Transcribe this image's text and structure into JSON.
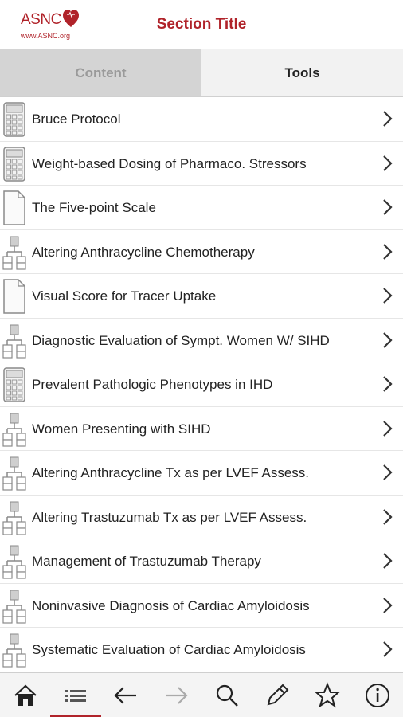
{
  "header": {
    "logo_text": "ASNC",
    "logo_url": "www.ASNC.org",
    "title": "Section Title"
  },
  "tabs": [
    {
      "label": "Content",
      "active": false
    },
    {
      "label": "Tools",
      "active": true
    }
  ],
  "list": {
    "items": [
      {
        "label": "Bruce Protocol",
        "icon": "calculator-icon"
      },
      {
        "label": "Weight-based Dosing of Pharmaco. Stressors",
        "icon": "calculator-icon"
      },
      {
        "label": "The Five-point Scale",
        "icon": "document-icon"
      },
      {
        "label": "Altering Anthracycline Chemotherapy",
        "icon": "flowchart-icon"
      },
      {
        "label": "Visual Score for Tracer Uptake",
        "icon": "document-icon"
      },
      {
        "label": "Diagnostic Evaluation of Sympt. Women W/ SIHD",
        "icon": "flowchart-icon"
      },
      {
        "label": "Prevalent Pathologic Phenotypes in IHD",
        "icon": "calculator-icon"
      },
      {
        "label": "Women Presenting with SIHD",
        "icon": "flowchart-icon"
      },
      {
        "label": "Altering Anthracycline Tx as per LVEF Assess.",
        "icon": "flowchart-icon"
      },
      {
        "label": "Altering Trastuzumab Tx as per LVEF Assess.",
        "icon": "flowchart-icon"
      },
      {
        "label": "Management of Trastuzumab Therapy",
        "icon": "flowchart-icon"
      },
      {
        "label": "Noninvasive Diagnosis of Cardiac Amyloidosis",
        "icon": "flowchart-icon"
      },
      {
        "label": "Systematic Evaluation of Cardiac Amyloidosis",
        "icon": "flowchart-icon"
      }
    ]
  },
  "bottombar": {
    "items": [
      "home-icon",
      "list-icon",
      "back-arrow-icon",
      "forward-arrow-icon",
      "search-icon",
      "pencil-icon",
      "star-icon",
      "info-icon"
    ],
    "active": "list-icon"
  },
  "colors": {
    "brand": "#b0232a",
    "tab_inactive_bg": "#d4d4d4",
    "tab_active_bg": "#f2f2f2"
  }
}
